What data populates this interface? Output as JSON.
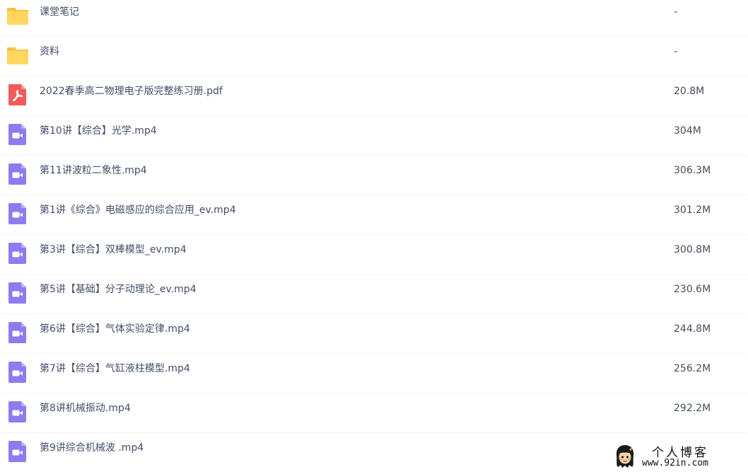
{
  "files": [
    {
      "name": "课堂笔记",
      "size": "-",
      "type": "folder"
    },
    {
      "name": "资料",
      "size": "-",
      "type": "folder"
    },
    {
      "name": "2022春季高二物理电子版完整练习册.pdf",
      "size": "20.8M",
      "type": "pdf"
    },
    {
      "name": "第10讲【综合】光学.mp4",
      "size": "304M",
      "type": "video"
    },
    {
      "name": "第11讲波粒二象性.mp4",
      "size": "306.3M",
      "type": "video"
    },
    {
      "name": "第1讲《综合》电磁感应的综合应用_ev.mp4",
      "size": "301.2M",
      "type": "video"
    },
    {
      "name": "第3讲【综合】双棒模型_ev.mp4",
      "size": "300.8M",
      "type": "video"
    },
    {
      "name": "第5讲【基础】分子动理论_ev.mp4",
      "size": "230.6M",
      "type": "video"
    },
    {
      "name": "第6讲【综合】气体实验定律.mp4",
      "size": "244.8M",
      "type": "video"
    },
    {
      "name": "第7讲【综合】气缸液柱模型.mp4",
      "size": "256.2M",
      "type": "video"
    },
    {
      "name": "第8讲机械振动.mp4",
      "size": "292.2M",
      "type": "video"
    },
    {
      "name": "第9讲综合机械波 .mp4",
      "size": "",
      "type": "video"
    }
  ],
  "watermark": {
    "title": "个人博客",
    "url": "www.92in.com"
  },
  "colors": {
    "folder": "#ffd75e",
    "pdf": "#f25a5a",
    "video": "#8c7cf0",
    "divider": "#f1f2f4",
    "text": "#424e67"
  },
  "icons": {
    "folder": "folder-icon",
    "pdf": "pdf-icon",
    "video": "video-icon"
  }
}
